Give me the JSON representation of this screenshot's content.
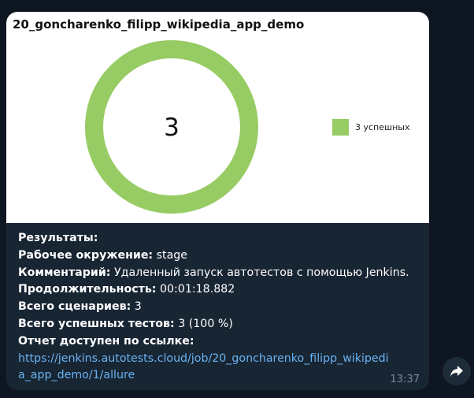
{
  "message": {
    "chart": {
      "title": "20_goncharenko_filipp_wikipedia_app_demo",
      "center_value": "3",
      "legend_label": "3 успешных",
      "color": "#97cc64"
    },
    "results_heading": "Результаты:",
    "env_label": "Рабочее окружение:",
    "env_value": " stage",
    "comment_label": "Комментарий:",
    "comment_value": " Удаленный запуск автотестов с помощью Jenkins.",
    "duration_label": "Продолжительность:",
    "duration_value": " 00:01:18.882",
    "scenarios_label": "Всего сценариев:",
    "scenarios_value": " 3",
    "passed_label": "Всего успешных тестов:",
    "passed_value": " 3 (100 %)",
    "report_label": "Отчет доступен по ссылке:",
    "report_link_line1": "https://jenkins.autotests.cloud/job/20_goncharenko_filipp_wikipedi",
    "report_link_line2": "a_app_demo/1/allure",
    "time": "13:37"
  },
  "share_icon": "share-arrow-icon"
}
